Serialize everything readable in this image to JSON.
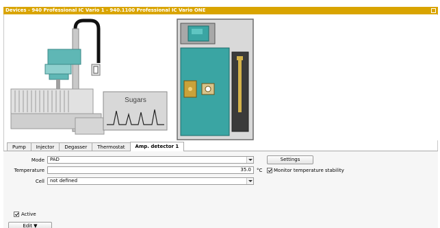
{
  "window": {
    "title": "Devices - 940 Professional IC Vario 1 - 940.1100 Professional IC Vario ONE"
  },
  "illustration": {
    "chromatogram_label": "Sugars"
  },
  "tabs": [
    {
      "label": "Pump"
    },
    {
      "label": "Injector"
    },
    {
      "label": "Degasser"
    },
    {
      "label": "Thermostat"
    },
    {
      "label": "Amp. detector 1",
      "active": true
    }
  ],
  "form": {
    "mode": {
      "label": "Mode",
      "value": "PAD"
    },
    "settings_button": "Settings",
    "temperature": {
      "label": "Temperature",
      "value": "35.0",
      "unit": "°C"
    },
    "monitor": {
      "label": "Monitor temperature stability",
      "checked": true
    },
    "cell": {
      "label": "Cell",
      "value": "not defined"
    },
    "active": {
      "label": "Active",
      "checked": true
    }
  },
  "footer": {
    "edit_button": "Edit ▼"
  },
  "colors": {
    "titlebar": "#d9a400",
    "instrument_teal": "#3aa5a3"
  }
}
